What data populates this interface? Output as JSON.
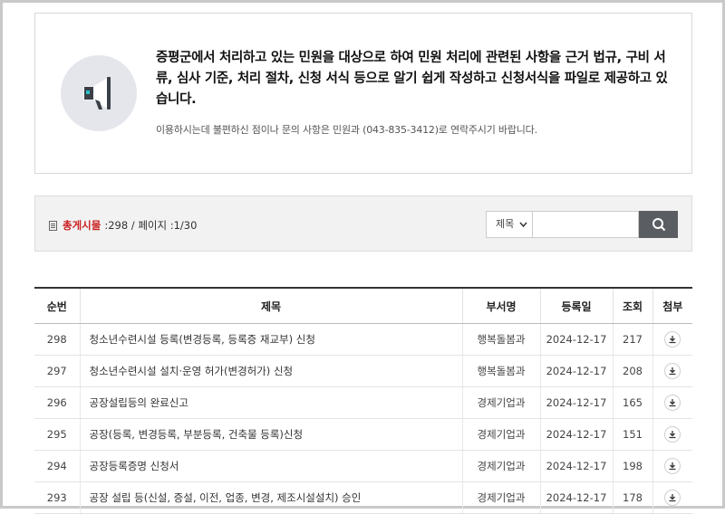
{
  "notice": {
    "main_text": "증평군에서 처리하고 있는 민원을 대상으로 하여 민원 처리에 관련된 사항을 근거 법규, 구비 서류, 심사 기준, 처리 절차, 신청 서식 등으로 알기 쉽게 작성하고 신청서식을 파일로 제공하고 있습니다.",
    "sub_text": "이용하시는데 불편하신 점이나 문의 사항은 민원과 (043-835-3412)로 연락주시기 바랍니다.",
    "icon": "megaphone-icon"
  },
  "search": {
    "count_label": "총게시물",
    "count_text": ":298 / 페이지 :1/30",
    "select_value": "제목",
    "input_placeholder": "",
    "button_icon": "search-icon"
  },
  "table": {
    "headers": [
      "순번",
      "제목",
      "부서명",
      "등록일",
      "조회",
      "첨부"
    ],
    "rows": [
      {
        "no": "298",
        "title": "청소년수련시설 등록(변경등록, 등록증 재교부) 신청",
        "dept": "행복돌봄과",
        "date": "2024-12-17",
        "views": "217"
      },
      {
        "no": "297",
        "title": "청소년수련시설 설치·운영 허가(변경허가) 신청",
        "dept": "행복돌봄과",
        "date": "2024-12-17",
        "views": "208"
      },
      {
        "no": "296",
        "title": "공장설립등의 완료신고",
        "dept": "경제기업과",
        "date": "2024-12-17",
        "views": "165"
      },
      {
        "no": "295",
        "title": "공장(등록, 변경등록, 부분등록, 건축물 등록)신청",
        "dept": "경제기업과",
        "date": "2024-12-17",
        "views": "151"
      },
      {
        "no": "294",
        "title": "공장등록증명 신청서",
        "dept": "경제기업과",
        "date": "2024-12-17",
        "views": "198"
      },
      {
        "no": "293",
        "title": "공장 설립 등(신설, 증설, 이전, 업종, 변경, 제조시설설치) 승인",
        "dept": "경제기업과",
        "date": "2024-12-17",
        "views": "178"
      }
    ],
    "attach_icon": "download-icon"
  }
}
